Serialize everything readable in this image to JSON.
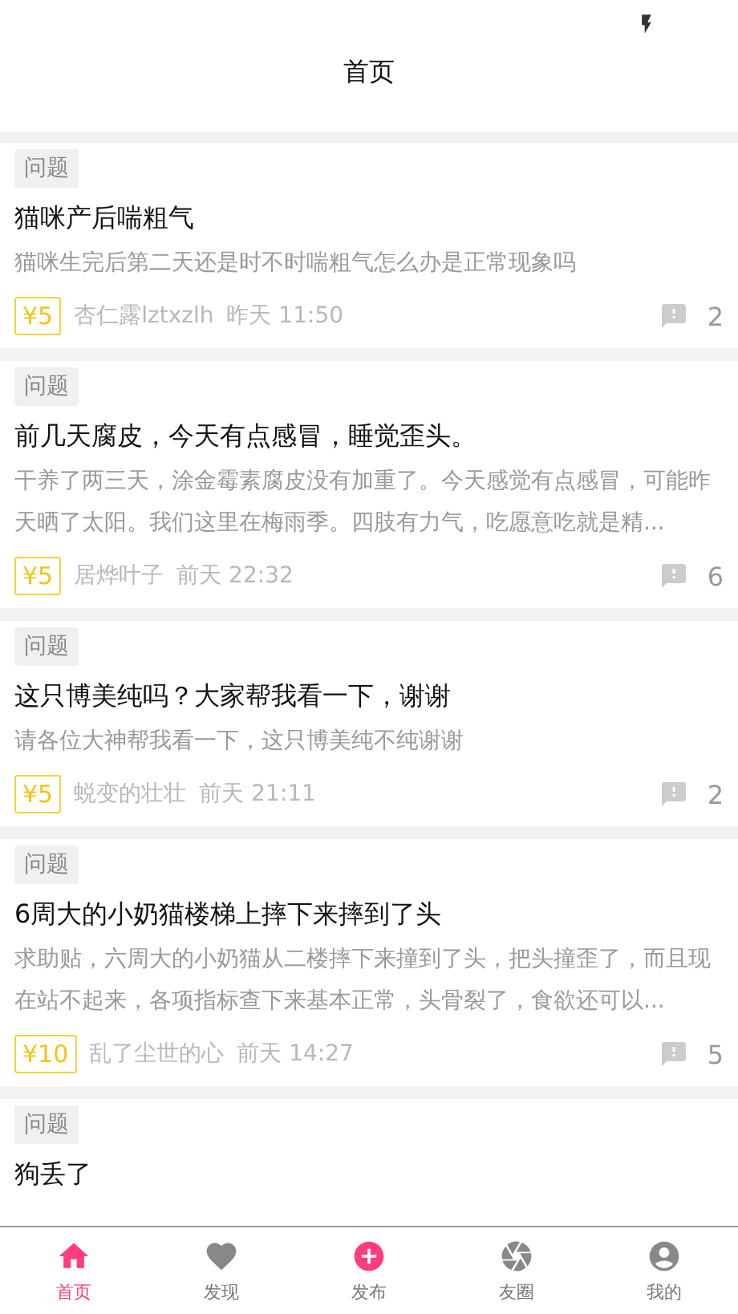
{
  "header": {
    "title": "首页"
  },
  "posts": [
    {
      "tag": "问题",
      "title": "猫咪产后喘粗气",
      "body": "猫咪生完后第二天还是时不时喘粗气怎么办是正常现象吗",
      "reward": "¥5",
      "author": "杏仁露lztxzlh",
      "time": "昨天 11:50",
      "comments": "2"
    },
    {
      "tag": "问题",
      "title": "前几天腐皮，今天有点感冒，睡觉歪头。",
      "body": "干养了两三天，涂金霉素腐皮没有加重了。今天感觉有点感冒，可能昨天晒了太阳。我们这里在梅雨季。四肢有力气，吃愿意吃就是精...",
      "reward": "¥5",
      "author": "居烨叶子",
      "time": "前天 22:32",
      "comments": "6"
    },
    {
      "tag": "问题",
      "title": "这只博美纯吗？大家帮我看一下，谢谢",
      "body": "请各位大神帮我看一下，这只博美纯不纯谢谢",
      "reward": "¥5",
      "author": "蜕变的壮壮",
      "time": "前天 21:11",
      "comments": "2"
    },
    {
      "tag": "问题",
      "title": "6周大的小奶猫楼梯上摔下来摔到了头",
      "body": "求助贴，六周大的小奶猫从二楼摔下来撞到了头，把头撞歪了，而且现在站不起来，各项指标查下来基本正常，头骨裂了，食欲还可以...",
      "reward": "¥10",
      "author": "乱了尘世的心",
      "time": "前天 14:27",
      "comments": "5"
    },
    {
      "tag": "问题",
      "title": "狗丢了"
    }
  ],
  "tabs": [
    {
      "kind": "home",
      "label": "首页",
      "selected": true
    },
    {
      "kind": "discover",
      "label": "发现",
      "selected": false
    },
    {
      "kind": "publish",
      "label": "发布",
      "selected": false
    },
    {
      "kind": "circle",
      "label": "友圈",
      "selected": false
    },
    {
      "kind": "mine",
      "label": "我的",
      "selected": false
    }
  ]
}
